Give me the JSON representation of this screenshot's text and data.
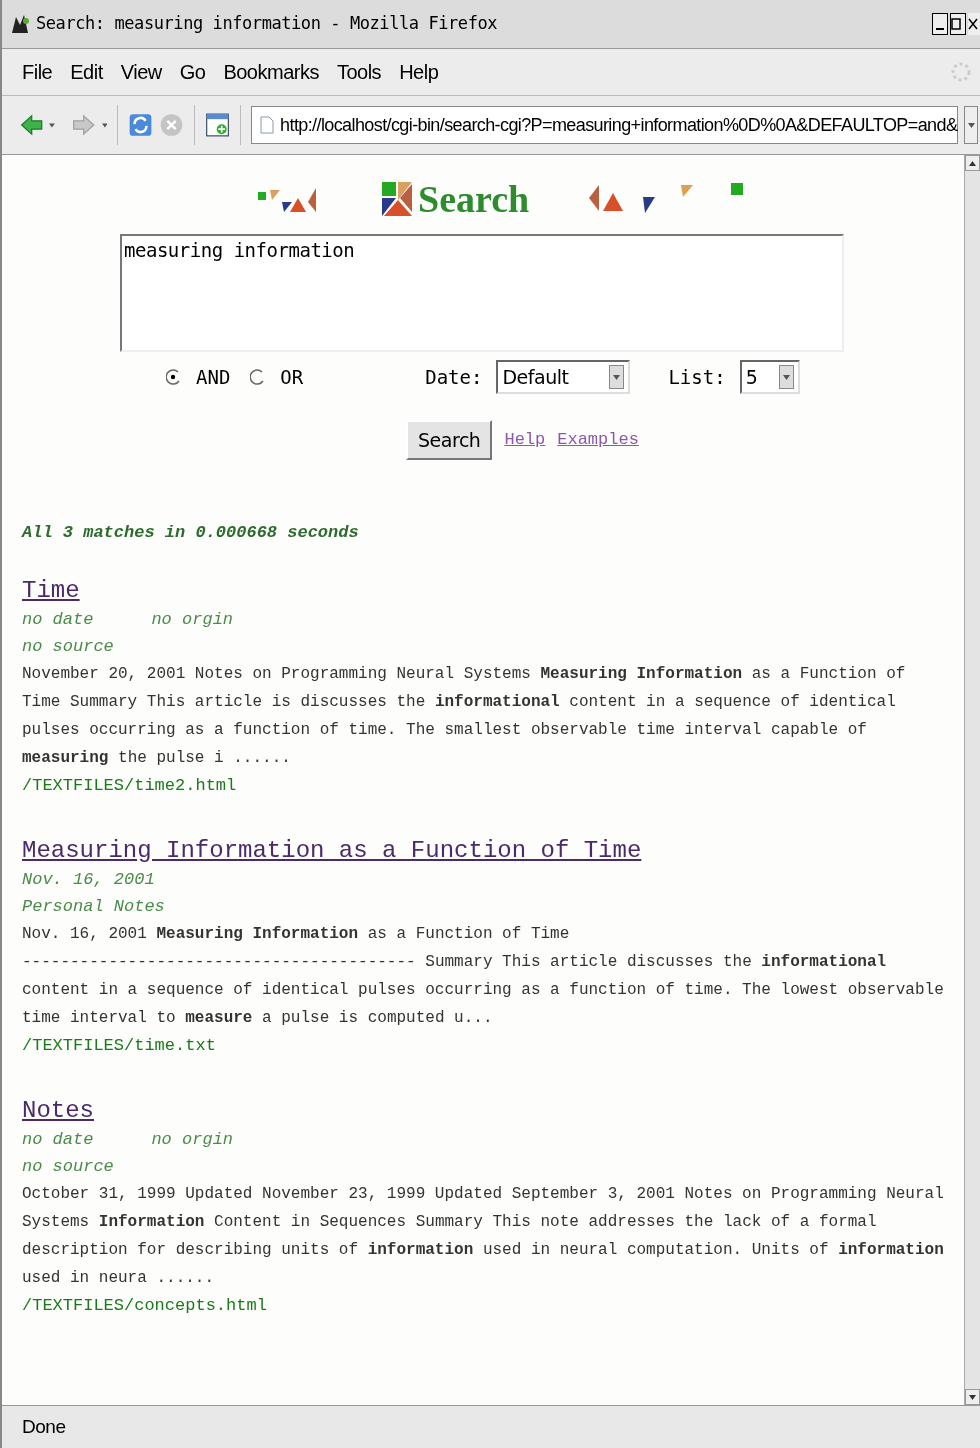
{
  "window": {
    "title": "Search: measuring information - Mozilla Firefox"
  },
  "menu": [
    "File",
    "Edit",
    "View",
    "Go",
    "Bookmarks",
    "Tools",
    "Help"
  ],
  "address": "http://localhost/cgi-bin/search-cgi?P=measuring+information%0D%0A&DEFAULTOP=and&",
  "nav": {
    "back_disabled": false,
    "forward_disabled": true,
    "stop_disabled": true
  },
  "logo": {
    "text": "Search"
  },
  "query": "measuring information",
  "operators": [
    {
      "label": "AND",
      "selected": true
    },
    {
      "label": "OR",
      "selected": false
    }
  ],
  "date": {
    "label": "Date:",
    "value": "Default"
  },
  "list": {
    "label": "List:",
    "value": "5"
  },
  "search_button": "Search",
  "links": [
    "Help",
    "Examples"
  ],
  "summary": "All 3 matches in 0.000668 seconds",
  "results": [
    {
      "title": "Time",
      "meta": [
        [
          "no date",
          "no orgin"
        ],
        [
          "no source"
        ]
      ],
      "snippet": "November 20, 2001 Notes on Programming Neural Systems **Measuring Information** as a Function of Time Summary This article is discusses the **informational** content in a sequence of identical pulses occurring as a function of time. The smallest observable time interval capable of **measuring** the pulse i ......",
      "path": "/TEXTFILES/time2.html"
    },
    {
      "title": "Measuring Information as a Function of Time",
      "meta": [
        [
          "Nov. 16, 2001"
        ],
        [
          "Personal Notes"
        ]
      ],
      "snippet": "Nov. 16, 2001 **Measuring Information** as a Function of Time ----------------------------------------- Summary This article discusses the **informational** content in a sequence of identical pulses occurring as a function of time. The lowest observable time interval to **measure** a pulse is computed u...",
      "path": "/TEXTFILES/time.txt"
    },
    {
      "title": "Notes",
      "meta": [
        [
          "no date",
          "no orgin"
        ],
        [
          "no source"
        ]
      ],
      "snippet": "October 31, 1999 Updated November 23, 1999 Updated September 3, 2001 Notes on Programming Neural Systems **Information** Content in Sequences Summary This note addresses the lack of a formal description for describing units of **information** used in neural computation. Units of **information** used in neura ......",
      "path": "/TEXTFILES/concepts.html"
    }
  ],
  "status": "Done"
}
